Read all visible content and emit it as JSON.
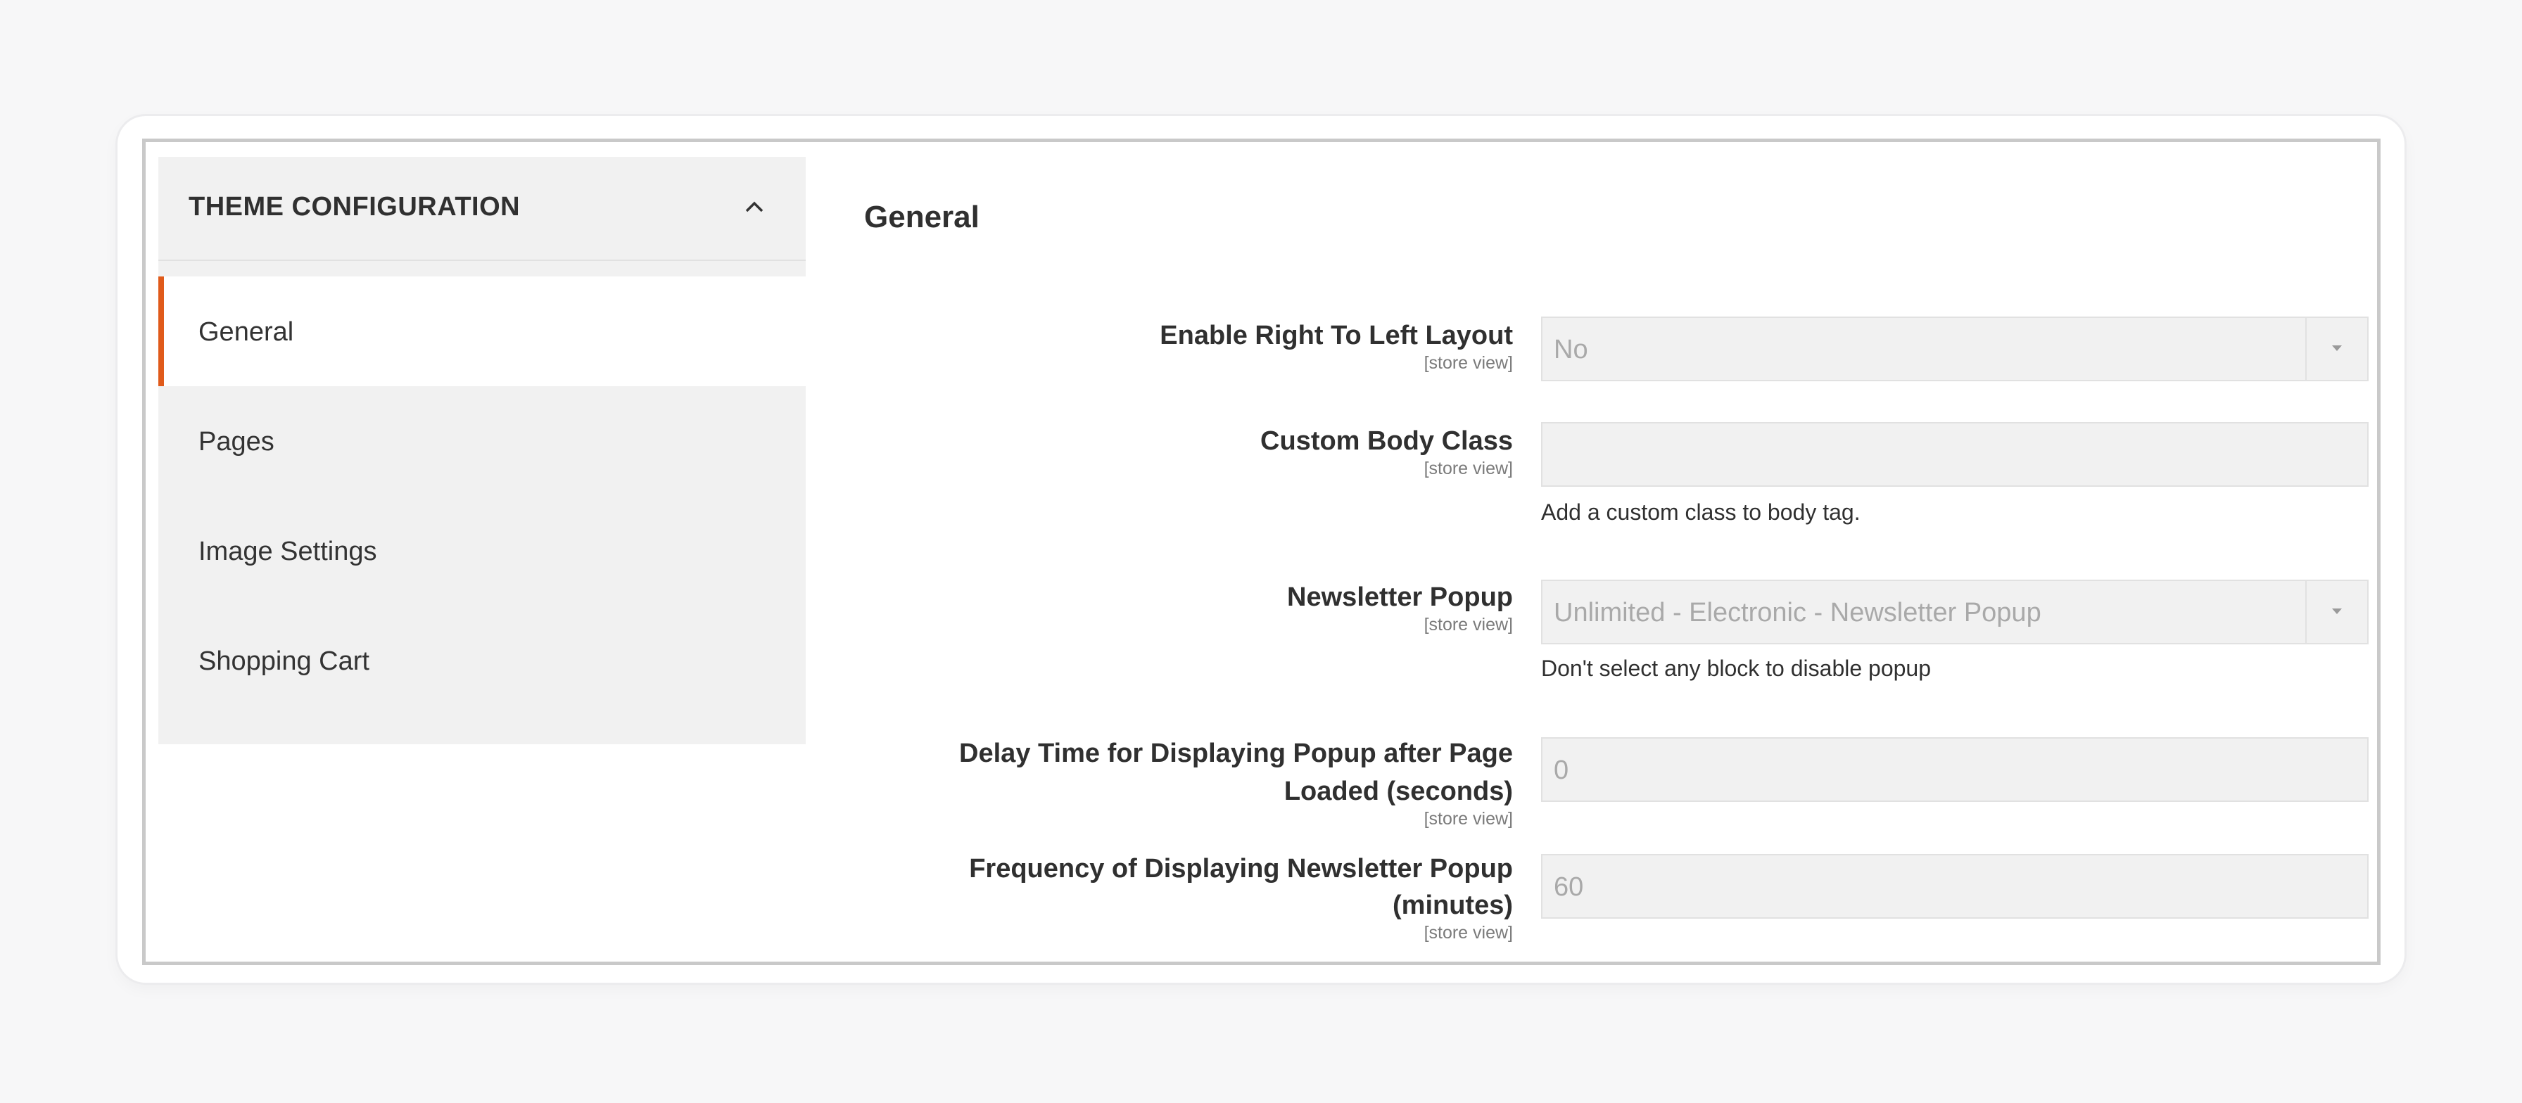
{
  "sidebar": {
    "title": "THEME CONFIGURATION",
    "items": [
      {
        "label": "General",
        "active": true
      },
      {
        "label": "Pages",
        "active": false
      },
      {
        "label": "Image Settings",
        "active": false
      },
      {
        "label": "Shopping Cart",
        "active": false
      }
    ]
  },
  "main": {
    "section_title": "General",
    "fields": [
      {
        "label_line1": "Enable Right To Left Layout",
        "scope": "[store view]",
        "value": "No",
        "type": "select"
      },
      {
        "label_line1": "Custom Body Class",
        "scope": "[store view]",
        "value": "",
        "note": "Add a custom class to body tag.",
        "type": "text"
      },
      {
        "label_line1": "Newsletter Popup",
        "scope": "[store view]",
        "value": "Unlimited - Electronic - Newsletter Popup",
        "note": "Don't select any block to disable popup",
        "type": "select"
      },
      {
        "label_line1": "Delay Time for Displaying Popup after Page",
        "label_line2": "Loaded (seconds)",
        "scope": "[store view]",
        "value": "0",
        "type": "text"
      },
      {
        "label_line1": "Frequency of Displaying Newsletter Popup",
        "label_line2": "(minutes)",
        "scope": "[store view]",
        "value": "60",
        "type": "text"
      }
    ]
  },
  "colors": {
    "accent": "#e05a1a",
    "sidebar_bg": "#f1f1f1",
    "field_bg": "#f1f1f1",
    "frame_border": "#c9c9c9"
  }
}
